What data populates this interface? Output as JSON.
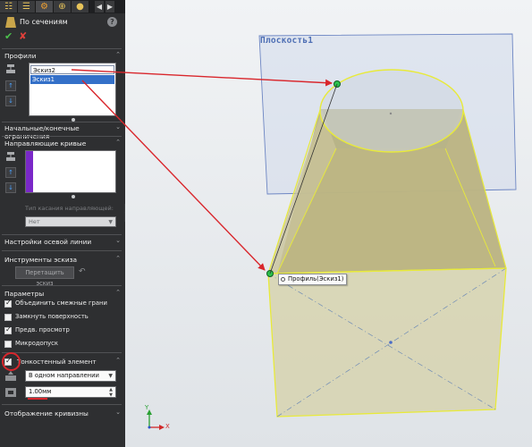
{
  "feature": {
    "title": "По сечениям",
    "help_icon": "help-icon"
  },
  "profiles": {
    "title": "Профили",
    "items": [
      "Эскиз2",
      "Эскиз1"
    ],
    "selected_index": 1
  },
  "constraints": {
    "title": "Начальные/конечные ограничения"
  },
  "guides": {
    "title": "Направляющие кривые",
    "tangency_label": "Тип касания направляющей:",
    "tangency_value": "Нет"
  },
  "centerline": {
    "title": "Настройки осевой линии"
  },
  "sketch_tools": {
    "title": "Инструменты эскиза",
    "drag_sketch_button": "Перетащить эскиз"
  },
  "options": {
    "title": "Параметры",
    "items": [
      {
        "label": "Объединить смежные грани",
        "checked": true
      },
      {
        "label": "Замкнуть поверхность",
        "checked": false
      },
      {
        "label": "Предв. просмотр",
        "checked": true
      },
      {
        "label": "Микродопуск",
        "checked": false
      }
    ]
  },
  "thin_feature": {
    "title": "Тонкостенный элемент",
    "checked": true,
    "direction": "В одном направлении",
    "thickness": "1.00мм"
  },
  "curvature": {
    "title": "Отображение кривизны"
  },
  "viewport": {
    "plane_label": "Плоскость1",
    "profile_tag": "Профиль(Эскиз1)",
    "triad_x": "X",
    "triad_y": "Y"
  },
  "colors": {
    "panel_bg": "#2e2f31",
    "selection": "#3470c8",
    "preview_yellow": "#e8ea3a",
    "arrow_red": "#d9262c",
    "plane_blue": "#6d86c3"
  }
}
